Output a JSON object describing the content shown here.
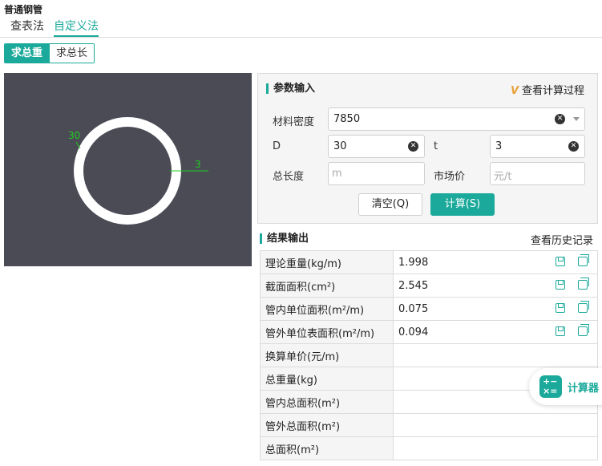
{
  "page": {
    "title": "普通钢管"
  },
  "tabs": [
    {
      "label": "查表法"
    },
    {
      "label": "自定义法"
    }
  ],
  "segment": {
    "weight": "求总重",
    "length": "求总长"
  },
  "diagram": {
    "d_label": "30",
    "t_label": "3"
  },
  "params": {
    "header": "参数输入",
    "process_link": "查看计算过程",
    "density": {
      "label": "材料密度",
      "value": "7850"
    },
    "d": {
      "label": "D",
      "value": "30"
    },
    "t": {
      "label": "t",
      "value": "3"
    },
    "total_length": {
      "label": "总长度",
      "placeholder": "m"
    },
    "price": {
      "label": "市场价",
      "placeholder": "元/t"
    },
    "clear_button": "清空(Q)",
    "calc_button": "计算(S)"
  },
  "results": {
    "header": "结果输出",
    "history_link": "查看历史记录",
    "rows": [
      {
        "label": "理论重量(kg/m)",
        "value": "1.998"
      },
      {
        "label": "截面面积(cm²)",
        "value": "2.545"
      },
      {
        "label": "管内单位面积(m²/m)",
        "value": "0.075"
      },
      {
        "label": "管外单位表面积(m²/m)",
        "value": "0.094"
      },
      {
        "label": "换算单价(元/m)",
        "value": ""
      },
      {
        "label": "总重量(kg)",
        "value": ""
      },
      {
        "label": "管内总面积(m²)",
        "value": ""
      },
      {
        "label": "管外总面积(m²)",
        "value": ""
      },
      {
        "label": "总面积(m²)",
        "value": ""
      }
    ]
  },
  "calculator": {
    "label": "计算器",
    "glyph": "+−\n×="
  },
  "colors": {
    "accent": "#1aa99a",
    "diagram_bg": "#4a4b55",
    "dimension": "#22cc22"
  }
}
